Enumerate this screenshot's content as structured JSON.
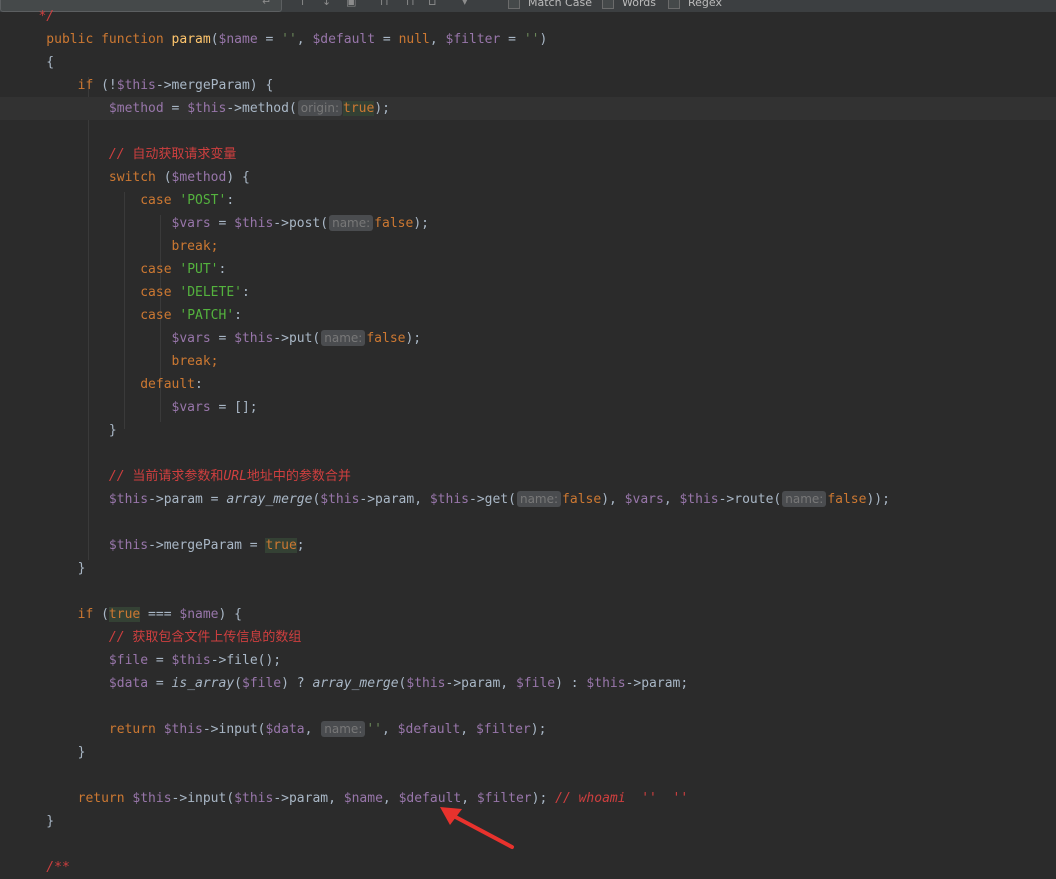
{
  "toolbar": {
    "options": [
      "Match Case",
      "Words",
      "Regex"
    ]
  },
  "code_lines": [
    {
      "tokens": [
        {
          "c": "cmt-i",
          "t": "   */"
        }
      ]
    },
    {
      "tokens": [
        {
          "c": "kw",
          "t": "    public function "
        },
        {
          "c": "fn",
          "t": "param"
        },
        {
          "c": "plain",
          "t": "("
        },
        {
          "c": "var",
          "t": "$name"
        },
        {
          "c": "plain",
          "t": " = "
        },
        {
          "c": "str",
          "t": "''"
        },
        {
          "c": "plain",
          "t": ", "
        },
        {
          "c": "var",
          "t": "$default"
        },
        {
          "c": "plain",
          "t": " = "
        },
        {
          "c": "kw",
          "t": "null"
        },
        {
          "c": "plain",
          "t": ", "
        },
        {
          "c": "var",
          "t": "$filter"
        },
        {
          "c": "plain",
          "t": " = "
        },
        {
          "c": "str",
          "t": "''"
        },
        {
          "c": "plain",
          "t": ")"
        }
      ]
    },
    {
      "tokens": [
        {
          "c": "plain",
          "t": "    {"
        }
      ]
    },
    {
      "tokens": [
        {
          "c": "kw",
          "t": "        if "
        },
        {
          "c": "plain",
          "t": "(!"
        },
        {
          "c": "var",
          "t": "$this"
        },
        {
          "c": "plain",
          "t": "->mergeParam) {"
        }
      ]
    },
    {
      "current": true,
      "tokens": [
        {
          "c": "var",
          "t": "            $method"
        },
        {
          "c": "plain",
          "t": " = "
        },
        {
          "c": "var",
          "t": "$this"
        },
        {
          "c": "plain",
          "t": "->method("
        },
        {
          "c": "hint",
          "t": "origin:"
        },
        {
          "c": "kw hl",
          "t": "true"
        },
        {
          "c": "plain",
          "t": ");"
        }
      ]
    },
    {
      "tokens": []
    },
    {
      "tokens": [
        {
          "c": "cmt-i",
          "t": "            // "
        },
        {
          "c": "cmt",
          "t": "自动获取请求变量"
        }
      ]
    },
    {
      "tokens": [
        {
          "c": "kw",
          "t": "            switch "
        },
        {
          "c": "plain",
          "t": "("
        },
        {
          "c": "var",
          "t": "$method"
        },
        {
          "c": "plain",
          "t": ") {"
        }
      ]
    },
    {
      "tokens": [
        {
          "c": "kw",
          "t": "                case "
        },
        {
          "c": "str2",
          "t": "'POST'"
        },
        {
          "c": "plain",
          "t": ":"
        }
      ]
    },
    {
      "tokens": [
        {
          "c": "var",
          "t": "                    $vars"
        },
        {
          "c": "plain",
          "t": " = "
        },
        {
          "c": "var",
          "t": "$this"
        },
        {
          "c": "plain",
          "t": "->post("
        },
        {
          "c": "hint",
          "t": "name:"
        },
        {
          "c": "kw",
          "t": "false"
        },
        {
          "c": "plain",
          "t": ");"
        }
      ]
    },
    {
      "tokens": [
        {
          "c": "kw",
          "t": "                    break;"
        }
      ]
    },
    {
      "tokens": [
        {
          "c": "kw",
          "t": "                case "
        },
        {
          "c": "str2",
          "t": "'PUT'"
        },
        {
          "c": "plain",
          "t": ":"
        }
      ]
    },
    {
      "tokens": [
        {
          "c": "kw",
          "t": "                case "
        },
        {
          "c": "str2",
          "t": "'DELETE'"
        },
        {
          "c": "plain",
          "t": ":"
        }
      ]
    },
    {
      "tokens": [
        {
          "c": "kw",
          "t": "                case "
        },
        {
          "c": "str2",
          "t": "'PATCH'"
        },
        {
          "c": "plain",
          "t": ":"
        }
      ]
    },
    {
      "tokens": [
        {
          "c": "var",
          "t": "                    $vars"
        },
        {
          "c": "plain",
          "t": " = "
        },
        {
          "c": "var",
          "t": "$this"
        },
        {
          "c": "plain",
          "t": "->put("
        },
        {
          "c": "hint",
          "t": "name:"
        },
        {
          "c": "kw",
          "t": "false"
        },
        {
          "c": "plain",
          "t": ");"
        }
      ]
    },
    {
      "tokens": [
        {
          "c": "kw",
          "t": "                    break;"
        }
      ]
    },
    {
      "tokens": [
        {
          "c": "kw",
          "t": "                default"
        },
        {
          "c": "plain",
          "t": ":"
        }
      ]
    },
    {
      "tokens": [
        {
          "c": "var",
          "t": "                    $vars"
        },
        {
          "c": "plain",
          "t": " = [];"
        }
      ]
    },
    {
      "tokens": [
        {
          "c": "plain",
          "t": "            }"
        }
      ]
    },
    {
      "tokens": []
    },
    {
      "tokens": [
        {
          "c": "cmt-i",
          "t": "            // "
        },
        {
          "c": "cmt",
          "t": "当前请求参数和"
        },
        {
          "c": "cmt-i",
          "t": "URL"
        },
        {
          "c": "cmt",
          "t": "地址中的参数合并"
        }
      ]
    },
    {
      "tokens": [
        {
          "c": "var",
          "t": "            $this"
        },
        {
          "c": "plain",
          "t": "->param = "
        },
        {
          "c": "italic-fn",
          "t": "array_merge"
        },
        {
          "c": "plain",
          "t": "("
        },
        {
          "c": "var",
          "t": "$this"
        },
        {
          "c": "plain",
          "t": "->param, "
        },
        {
          "c": "var",
          "t": "$this"
        },
        {
          "c": "plain",
          "t": "->get("
        },
        {
          "c": "hint",
          "t": "name:"
        },
        {
          "c": "kw",
          "t": "false"
        },
        {
          "c": "plain",
          "t": "), "
        },
        {
          "c": "var",
          "t": "$vars"
        },
        {
          "c": "plain",
          "t": ", "
        },
        {
          "c": "var",
          "t": "$this"
        },
        {
          "c": "plain",
          "t": "->route("
        },
        {
          "c": "hint",
          "t": "name:"
        },
        {
          "c": "kw",
          "t": "false"
        },
        {
          "c": "plain",
          "t": "));"
        }
      ]
    },
    {
      "tokens": []
    },
    {
      "tokens": [
        {
          "c": "var",
          "t": "            $this"
        },
        {
          "c": "plain",
          "t": "->mergeParam = "
        },
        {
          "c": "kw hl",
          "t": "true"
        },
        {
          "c": "plain",
          "t": ";"
        }
      ]
    },
    {
      "tokens": [
        {
          "c": "plain",
          "t": "        }"
        }
      ]
    },
    {
      "tokens": []
    },
    {
      "tokens": [
        {
          "c": "kw",
          "t": "        if "
        },
        {
          "c": "plain",
          "t": "("
        },
        {
          "c": "kw hl",
          "t": "true"
        },
        {
          "c": "plain",
          "t": " === "
        },
        {
          "c": "var",
          "t": "$name"
        },
        {
          "c": "plain",
          "t": ") {"
        }
      ]
    },
    {
      "tokens": [
        {
          "c": "cmt-i",
          "t": "            // "
        },
        {
          "c": "cmt",
          "t": "获取包含文件上传信息的数组"
        }
      ]
    },
    {
      "tokens": [
        {
          "c": "var",
          "t": "            $file"
        },
        {
          "c": "plain",
          "t": " = "
        },
        {
          "c": "var",
          "t": "$this"
        },
        {
          "c": "plain",
          "t": "->file();"
        }
      ]
    },
    {
      "tokens": [
        {
          "c": "var",
          "t": "            $data"
        },
        {
          "c": "plain",
          "t": " = "
        },
        {
          "c": "italic-fn",
          "t": "is_array"
        },
        {
          "c": "plain",
          "t": "("
        },
        {
          "c": "var",
          "t": "$file"
        },
        {
          "c": "plain",
          "t": ") ? "
        },
        {
          "c": "italic-fn",
          "t": "array_merge"
        },
        {
          "c": "plain",
          "t": "("
        },
        {
          "c": "var",
          "t": "$this"
        },
        {
          "c": "plain",
          "t": "->param, "
        },
        {
          "c": "var",
          "t": "$file"
        },
        {
          "c": "plain",
          "t": ") : "
        },
        {
          "c": "var",
          "t": "$this"
        },
        {
          "c": "plain",
          "t": "->param;"
        }
      ]
    },
    {
      "tokens": []
    },
    {
      "tokens": [
        {
          "c": "kw",
          "t": "            return "
        },
        {
          "c": "var",
          "t": "$this"
        },
        {
          "c": "plain",
          "t": "->input("
        },
        {
          "c": "var",
          "t": "$data"
        },
        {
          "c": "plain",
          "t": ", "
        },
        {
          "c": "hint",
          "t": "name:"
        },
        {
          "c": "str",
          "t": "''"
        },
        {
          "c": "plain",
          "t": ", "
        },
        {
          "c": "var",
          "t": "$default"
        },
        {
          "c": "plain",
          "t": ", "
        },
        {
          "c": "var",
          "t": "$filter"
        },
        {
          "c": "plain",
          "t": ");"
        }
      ]
    },
    {
      "tokens": [
        {
          "c": "plain",
          "t": "        }"
        }
      ]
    },
    {
      "tokens": []
    },
    {
      "tokens": [
        {
          "c": "kw",
          "t": "        return "
        },
        {
          "c": "var",
          "t": "$this"
        },
        {
          "c": "plain",
          "t": "->input("
        },
        {
          "c": "var",
          "t": "$this"
        },
        {
          "c": "plain",
          "t": "->param, "
        },
        {
          "c": "var",
          "t": "$name"
        },
        {
          "c": "plain",
          "t": ", "
        },
        {
          "c": "var",
          "t": "$default"
        },
        {
          "c": "plain",
          "t": ", "
        },
        {
          "c": "var",
          "t": "$filter"
        },
        {
          "c": "plain",
          "t": "); "
        },
        {
          "c": "cmt-i",
          "t": "// whoami  ''  ''"
        }
      ]
    },
    {
      "tokens": [
        {
          "c": "plain",
          "t": "    }"
        }
      ]
    },
    {
      "tokens": []
    },
    {
      "tokens": [
        {
          "c": "cmt-i",
          "t": "    /**"
        }
      ]
    }
  ]
}
